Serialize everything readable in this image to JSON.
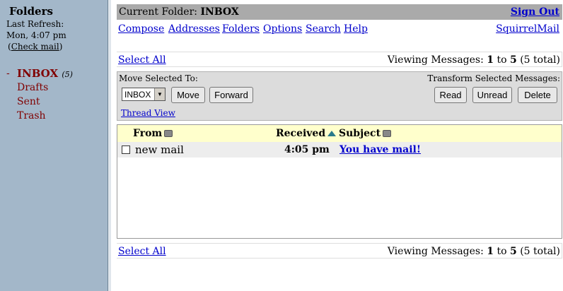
{
  "folder_pane": {
    "title": "Folders",
    "last_refresh_label": "Last Refresh:",
    "refresh_time": "Mon, 4:07 pm",
    "check_mail_open": "(",
    "check_mail_label": "Check mail",
    "check_mail_close": ")",
    "current_marker": "-",
    "folders": [
      {
        "name": "INBOX",
        "count": "(5)"
      },
      {
        "name": "Drafts"
      },
      {
        "name": "Sent"
      },
      {
        "name": "Trash"
      }
    ]
  },
  "title_bar": {
    "current_folder_label": "Current Folder:",
    "current_folder": "INBOX",
    "sign_out": "Sign Out"
  },
  "nav": {
    "items": [
      "Compose",
      "Addresses",
      "Folders",
      "Options",
      "Search",
      "Help"
    ],
    "brand_link": "SquirrelMail"
  },
  "paging": {
    "select_all": "Select All",
    "viewing_prefix": "Viewing Messages:",
    "from": "1",
    "to_word": "to",
    "to": "5",
    "total": "(5 total)"
  },
  "actions": {
    "move_label": "Move Selected To:",
    "folder_selected": "INBOX",
    "move_button": "Move",
    "forward_button": "Forward",
    "transform_label": "Transform Selected Messages:",
    "read_button": "Read",
    "unread_button": "Unread",
    "delete_button": "Delete",
    "thread_view": "Thread View"
  },
  "message_list": {
    "columns": {
      "from": "From",
      "received": "Received",
      "subject": "Subject"
    },
    "messages": [
      {
        "from": "new mail",
        "received": "4:05 pm",
        "subject": "You have mail!"
      }
    ]
  },
  "colors": {
    "folder_pane_bg": "#a3b7c9",
    "title_bar_bg": "#aaaaaa",
    "header_row_bg": "#ffffcc",
    "link": "#0000cc",
    "folder_link": "#800000"
  }
}
